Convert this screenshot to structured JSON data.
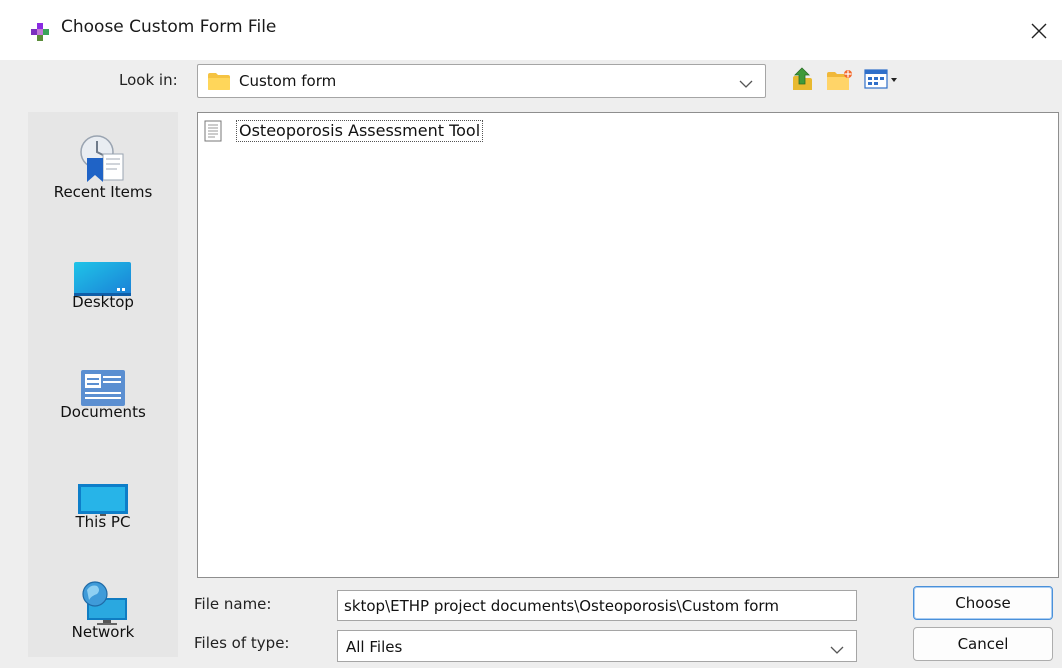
{
  "window": {
    "title": "Choose Custom Form File",
    "app_icon": "app-logo-icon",
    "close_icon": "close-icon"
  },
  "look_in": {
    "label": "Look in:",
    "value": "Custom form",
    "icon": "folder-icon"
  },
  "toolbar": {
    "up_icon": "up-one-level-icon",
    "new_folder_icon": "new-folder-icon",
    "views_icon": "view-menu-icon"
  },
  "places": [
    {
      "label": "Recent Items",
      "icon": "recent-items-icon"
    },
    {
      "label": "Desktop",
      "icon": "desktop-icon"
    },
    {
      "label": "Documents",
      "icon": "documents-icon"
    },
    {
      "label": "This PC",
      "icon": "this-pc-icon"
    },
    {
      "label": "Network",
      "icon": "network-icon"
    }
  ],
  "files": [
    {
      "name": "Osteoporosis Assessment Tool",
      "icon": "file-icon"
    }
  ],
  "file_name": {
    "label": "File name:",
    "value": "sktop\\ETHP project documents\\Osteoporosis\\Custom form"
  },
  "files_of_type": {
    "label": "Files of type:",
    "value": "All Files"
  },
  "buttons": {
    "choose": "Choose",
    "cancel": "Cancel"
  },
  "colors": {
    "dialog_background": "#eeeeee",
    "sidebar_background": "#e6e6e6",
    "accent_border": "#4a90d9",
    "folder_yellow": "#f5c342"
  }
}
